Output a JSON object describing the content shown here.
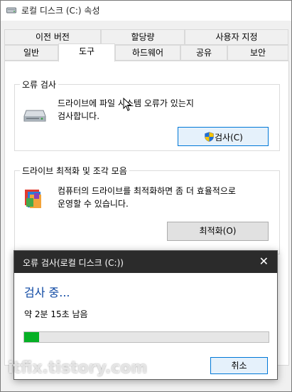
{
  "window": {
    "title": "로컬 디스크 (C:) 속성"
  },
  "tabs": {
    "row1": [
      "이전 버전",
      "할당량",
      "사용자 지정"
    ],
    "row2": [
      "일반",
      "도구",
      "하드웨어",
      "공유",
      "보안"
    ],
    "active": "도구"
  },
  "error_check": {
    "title": "오류 검사",
    "description_line1": "드라이브에 파일 시스템 오류가 있는지",
    "description_line2": "검사합니다.",
    "button_label": "검사(C)",
    "icon": "hard-drive-icon",
    "button_icon": "uac-shield-icon"
  },
  "optimize": {
    "title": "드라이브 최적화 및 조각 모음",
    "description_line1": "컴퓨터의 드라이브를 최적화하면 좀 더 효율적으로",
    "description_line2": "운영할 수 있습니다.",
    "button_label": "최적화(O)",
    "icon": "defrag-icon"
  },
  "dialog": {
    "title": "오류 검사(로컬 디스크 (C:))",
    "heading": "검사 중...",
    "time_remaining": "약 2분 15초 남음",
    "progress": 0.06,
    "cancel_label": "취소",
    "close_symbol": "✕"
  },
  "watermark": "itfix.tistory.com",
  "colors": {
    "dialog_titlebar": "#2b2b2b",
    "heading_blue": "#0b46a2",
    "progress_green": "#06b025",
    "focus_blue": "#0078d7"
  }
}
